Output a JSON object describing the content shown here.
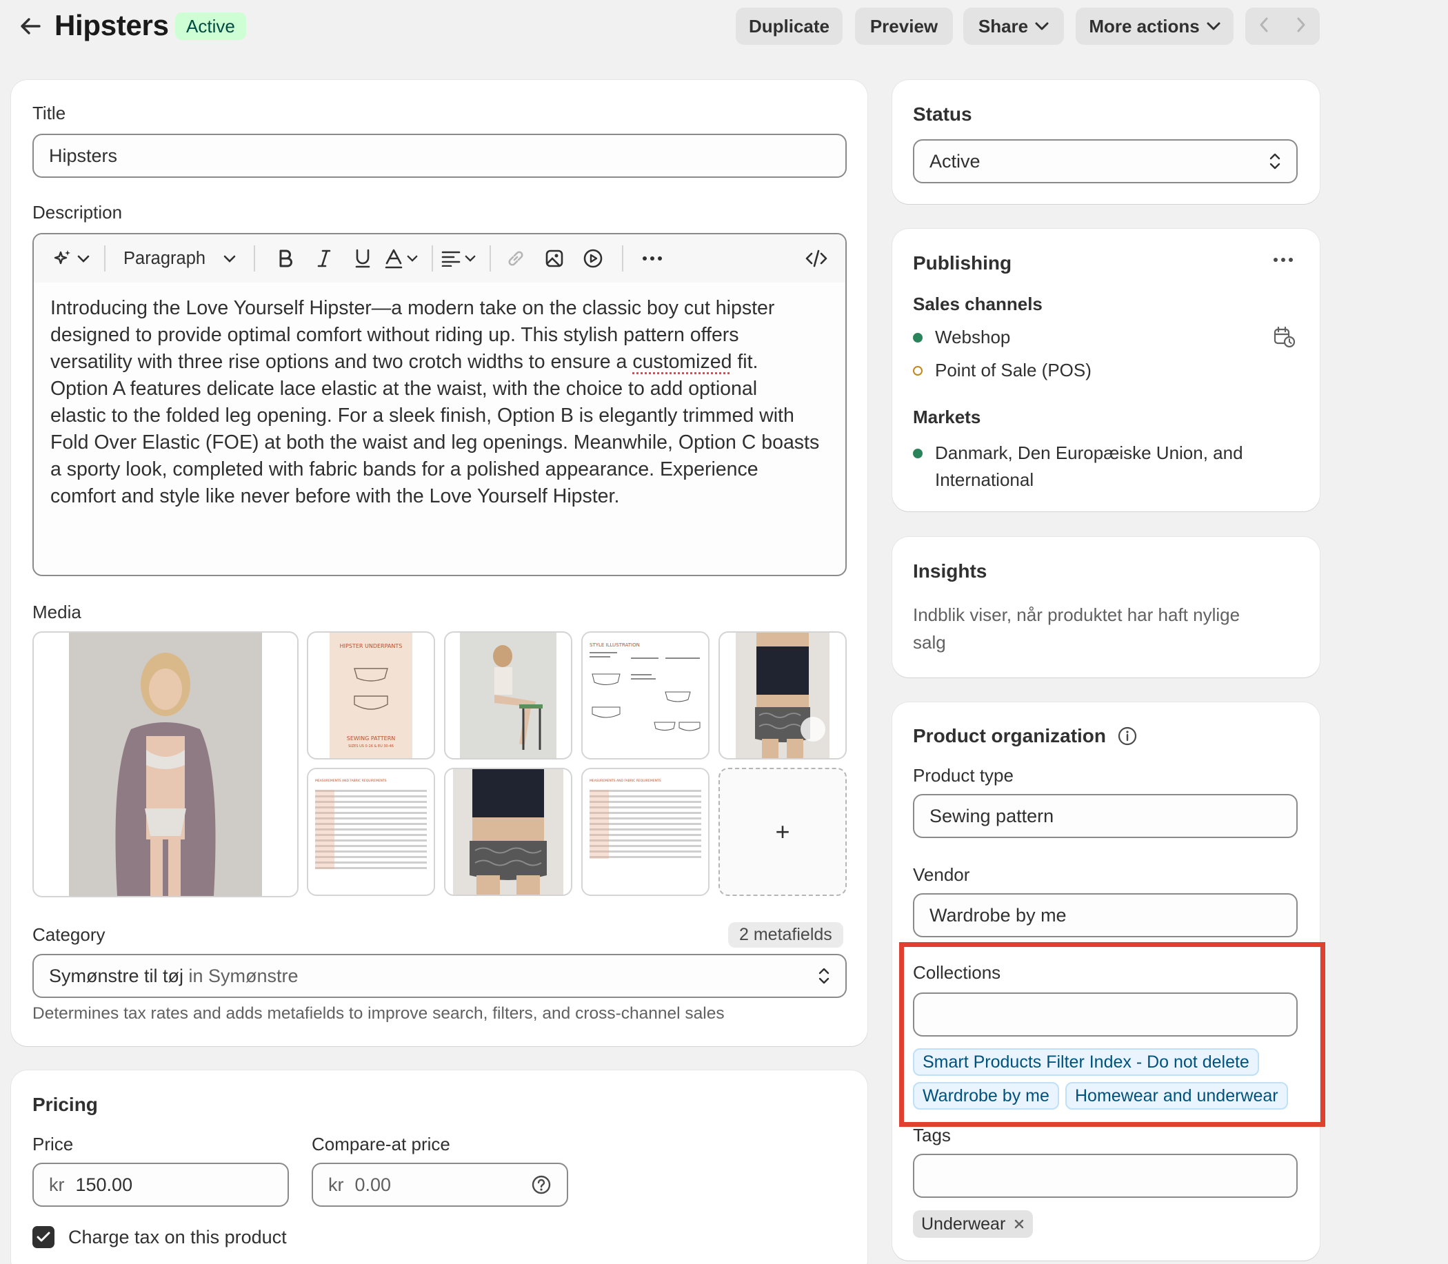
{
  "header": {
    "title": "Hipsters",
    "status_badge": "Active",
    "buttons": {
      "duplicate": "Duplicate",
      "preview": "Preview",
      "share": "Share",
      "more_actions": "More actions"
    }
  },
  "main": {
    "title_label": "Title",
    "title_value": "Hipsters",
    "description_label": "Description",
    "toolbar": {
      "paragraph": "Paragraph"
    },
    "description_lines": [
      "Introducing the Love Yourself Hipster—a modern take on the classic boy cut hipster",
      "designed to provide optimal comfort without riding up. This stylish pattern offers",
      "versatility with three rise options and two crotch widths to ensure a ",
      "customized",
      " fit.",
      "Option A features delicate lace elastic at the waist, with the choice to add optional",
      "elastic to the folded leg opening. For a sleek finish, Option B is elegantly trimmed with",
      "Fold Over Elastic (FOE) at both the waist and leg openings. Meanwhile, Option C boasts",
      "a sporty look, completed with fabric bands for a polished appearance. Experience",
      "comfort and style like never before with the Love Yourself Hipster."
    ],
    "media_label": "Media",
    "media_thumb_texts": {
      "pattern_cover_title": "HIPSTER UNDERPANTS",
      "pattern_cover_sub": "SEWING PATTERN",
      "pattern_cover_sizes": "SIZES US 0-16 & EU 30-46",
      "style_illustration": "STYLE ILLUSTRATION",
      "measure_chart": "MEASUREMENTS AND FABRIC REQUIREMENTS",
      "add": "+"
    },
    "category_label": "Category",
    "category_metafields": "2 metafields",
    "category_value": "Symønstre til tøj",
    "category_parent": "in Symønstre",
    "category_help": "Determines tax rates and adds metafields to improve search, filters, and cross-channel sales"
  },
  "pricing": {
    "title": "Pricing",
    "price_label": "Price",
    "currency": "kr",
    "price_value": "150.00",
    "compare_label": "Compare-at price",
    "compare_value": "0.00",
    "charge_tax": "Charge tax on this product"
  },
  "sidebar": {
    "status": {
      "title": "Status",
      "value": "Active"
    },
    "publishing": {
      "title": "Publishing",
      "sales_channels_label": "Sales channels",
      "channels": [
        "Webshop",
        "Point of Sale (POS)"
      ],
      "markets_label": "Markets",
      "markets_line1": "Danmark, Den Europæiske Union, and",
      "markets_line2": "International"
    },
    "insights": {
      "title": "Insights",
      "line1": "Indblik viser, når produktet har haft nylige",
      "line2": "salg"
    },
    "organization": {
      "title": "Product organization",
      "product_type_label": "Product type",
      "product_type_value": "Sewing pattern",
      "vendor_label": "Vendor",
      "vendor_value": "Wardrobe by me",
      "collections_label": "Collections",
      "collections": [
        "Smart Products Filter Index - Do not delete",
        "Wardrobe by me",
        "Homewear and underwear"
      ],
      "tags_label": "Tags",
      "tags": [
        "Underwear"
      ]
    }
  },
  "colors": {
    "accent_highlight": "#e0402f",
    "active_green": "#29845a",
    "pos_outline": "#c4861d"
  }
}
